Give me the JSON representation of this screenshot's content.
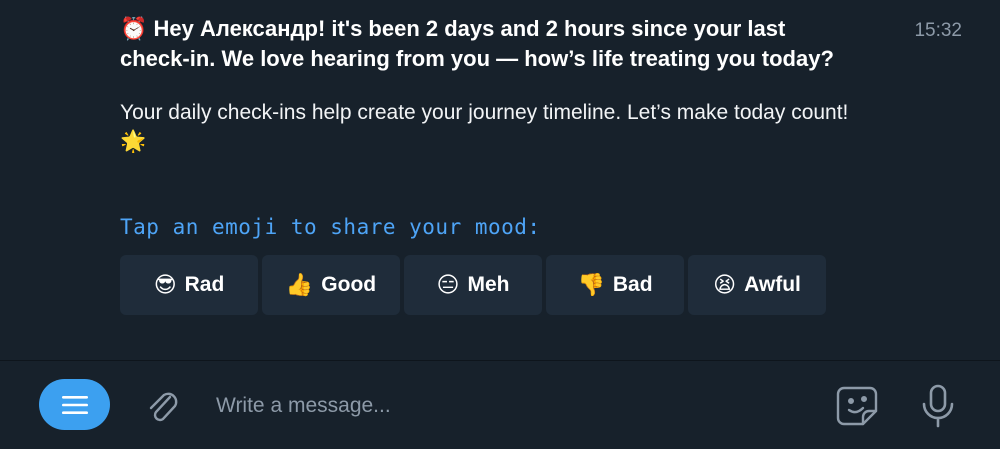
{
  "message": {
    "alarm_emoji": "⏰",
    "greeting": "Hey Александр! it's been 2 days and 2 hours since your last check-in. We love hearing from you — how’s life treating you today?",
    "body": "Your daily check-ins help create your journey timeline. Let’s make today count!",
    "star_emoji": "🌟",
    "timestamp": "15:32"
  },
  "mood": {
    "prompt": "Tap an emoji to share your mood:",
    "options": [
      {
        "emoji": "😎",
        "label": "Rad"
      },
      {
        "emoji": "👍",
        "label": "Good"
      },
      {
        "emoji": "😑",
        "label": "Meh"
      },
      {
        "emoji": "👎",
        "label": "Bad"
      },
      {
        "emoji": "😫",
        "label": "Awful"
      }
    ]
  },
  "composer": {
    "placeholder": "Write a message...",
    "icons": [
      "menu-icon",
      "paperclip-icon",
      "sticker-icon",
      "microphone-icon"
    ]
  },
  "colors": {
    "background": "#17212b",
    "button": "#1f2c3a",
    "accent": "#3ca0f0",
    "prompt_text": "#4ea4f6",
    "muted": "#8d9aa8"
  }
}
